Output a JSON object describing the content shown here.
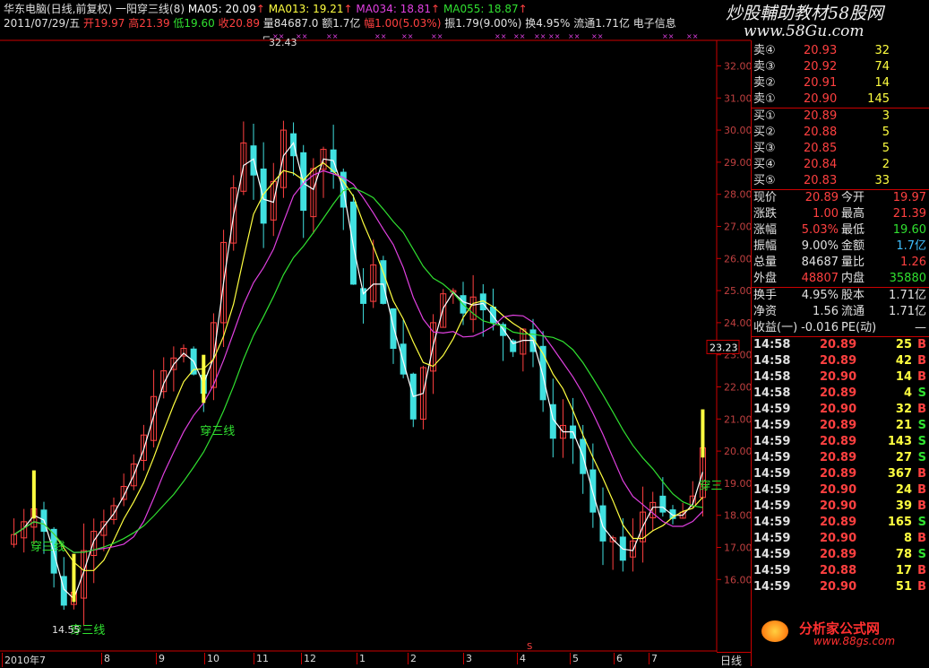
{
  "header": {
    "stock": "华东电脑(日线,前复权)",
    "formula": "一阳穿三线(8)",
    "ma05_label": "MA05: 20.09",
    "ma013_label": "MA013: 19.21",
    "ma034_label": "MA034: 18.81",
    "ma055_label": "MA055: 18.87",
    "date": "2011/07/29/五",
    "open": "开19.97",
    "high": "高21.39",
    "low": "低19.60",
    "close": "收20.89",
    "vol": "量84687.0",
    "amount": "额1.7亿",
    "change": "幅1.00(5.03%)",
    "amplitude": "振1.79(9.00%)",
    "turnover": "换4.95%",
    "float": "流通1.71亿",
    "sector": "电子信息"
  },
  "annotations": {
    "high_mark": "32.43",
    "low_mark": "14.55",
    "cross_label": "穿三线",
    "cross_label_edge": "穿三",
    "crosshair_price": "23.23",
    "s_mark": "S"
  },
  "y_axis": [
    "32.00",
    "31.00",
    "30.00",
    "29.00",
    "28.00",
    "27.00",
    "26.00",
    "25.00",
    "24.00",
    "23.00",
    "22.00",
    "21.00",
    "20.00",
    "19.00",
    "18.00",
    "17.00",
    "16.00"
  ],
  "x_axis": [
    "2010年7",
    "8",
    "9",
    "10",
    "11",
    "12",
    "1",
    "2",
    "3",
    "4",
    "5",
    "6",
    "7"
  ],
  "period_tab": "日线",
  "orderbook": {
    "sell": [
      {
        "label": "卖④",
        "price": "20.93",
        "vol": "32"
      },
      {
        "label": "卖③",
        "price": "20.92",
        "vol": "74"
      },
      {
        "label": "卖②",
        "price": "20.91",
        "vol": "14"
      },
      {
        "label": "卖①",
        "price": "20.90",
        "vol": "145"
      }
    ],
    "buy": [
      {
        "label": "买①",
        "price": "20.89",
        "vol": "3"
      },
      {
        "label": "买②",
        "price": "20.88",
        "vol": "5"
      },
      {
        "label": "买③",
        "price": "20.85",
        "vol": "5"
      },
      {
        "label": "买④",
        "price": "20.84",
        "vol": "2"
      },
      {
        "label": "买⑤",
        "price": "20.83",
        "vol": "33"
      }
    ]
  },
  "quote": [
    {
      "l1": "现价",
      "v1": "20.89",
      "l2": "今开",
      "v2": "19.97",
      "c1": "r",
      "c2": "r"
    },
    {
      "l1": "涨跌",
      "v1": "1.00",
      "l2": "最高",
      "v2": "21.39",
      "c1": "r",
      "c2": "r"
    },
    {
      "l1": "涨幅",
      "v1": "5.03%",
      "l2": "最低",
      "v2": "19.60",
      "c1": "r",
      "c2": "g"
    },
    {
      "l1": "振幅",
      "v1": "9.00%",
      "l2": "金额",
      "v2": "1.7亿",
      "c1": "w",
      "c2": "c"
    },
    {
      "l1": "总量",
      "v1": "84687",
      "l2": "量比",
      "v2": "1.26",
      "c1": "w",
      "c2": "r"
    },
    {
      "l1": "外盘",
      "v1": "48807",
      "l2": "内盘",
      "v2": "35880",
      "c1": "r",
      "c2": "g"
    },
    {
      "l1": "换手",
      "v1": "4.95%",
      "l2": "股本",
      "v2": "1.71亿",
      "c1": "w",
      "c2": "w"
    },
    {
      "l1": "净资",
      "v1": "1.56",
      "l2": "流通",
      "v2": "1.71亿",
      "c1": "w",
      "c2": "w"
    },
    {
      "l1": "收益(一)",
      "v1": "-0.016",
      "l2": "PE(动)",
      "v2": "—",
      "c1": "w",
      "c2": "w"
    }
  ],
  "ticks": [
    {
      "t": "14:58",
      "p": "20.89",
      "v": "25",
      "s": "B"
    },
    {
      "t": "14:58",
      "p": "20.89",
      "v": "42",
      "s": "B"
    },
    {
      "t": "14:58",
      "p": "20.90",
      "v": "14",
      "s": "B"
    },
    {
      "t": "14:58",
      "p": "20.89",
      "v": "4",
      "s": "S"
    },
    {
      "t": "14:59",
      "p": "20.90",
      "v": "32",
      "s": "B"
    },
    {
      "t": "14:59",
      "p": "20.89",
      "v": "21",
      "s": "S"
    },
    {
      "t": "14:59",
      "p": "20.89",
      "v": "143",
      "s": "S"
    },
    {
      "t": "14:59",
      "p": "20.89",
      "v": "27",
      "s": "S"
    },
    {
      "t": "14:59",
      "p": "20.89",
      "v": "367",
      "s": "B"
    },
    {
      "t": "14:59",
      "p": "20.90",
      "v": "24",
      "s": "B"
    },
    {
      "t": "14:59",
      "p": "20.90",
      "v": "39",
      "s": "B"
    },
    {
      "t": "14:59",
      "p": "20.89",
      "v": "165",
      "s": "S"
    },
    {
      "t": "14:59",
      "p": "20.90",
      "v": "8",
      "s": "B"
    },
    {
      "t": "14:59",
      "p": "20.89",
      "v": "78",
      "s": "S"
    },
    {
      "t": "14:59",
      "p": "20.88",
      "v": "17",
      "s": "B"
    },
    {
      "t": "14:59",
      "p": "20.90",
      "v": "51",
      "s": "B"
    }
  ],
  "watermark": {
    "top_line1": "炒股輔助教材58股网",
    "top_line2": "www.58Gu.com",
    "bottom_line1": "分析家公式网",
    "bottom_line2": "www.88gs.com"
  },
  "colors": {
    "up": "#ff4040",
    "down": "#30e030",
    "ma5": "#ffffff",
    "ma13": "#ffff40",
    "ma34": "#e040e0",
    "ma55": "#30e030",
    "border": "#cc0000"
  },
  "chart_data": {
    "type": "candlestick",
    "ylim": [
      14.5,
      32.6
    ],
    "close_approx": [
      17.4,
      17.8,
      18.2,
      17.5,
      16.2,
      15.2,
      15.6,
      16.9,
      17.5,
      17.8,
      18.3,
      18.9,
      19.6,
      20.5,
      21.7,
      22.5,
      22.9,
      23.2,
      22.4,
      21.8,
      24.0,
      26.5,
      28.2,
      29.6,
      28.6,
      27.1,
      28.4,
      30.0,
      29.2,
      27.5,
      28.8,
      29.4,
      28.7,
      27.6,
      25.2,
      24.6,
      25.8,
      24.6,
      23.2,
      22.4,
      21.0,
      22.6,
      24.0,
      24.9,
      25.0,
      24.3,
      24.8,
      24.4,
      24.0,
      23.6,
      23.1,
      23.8,
      23.1,
      21.6,
      20.4,
      20.8,
      20.4,
      19.3,
      18.1,
      17.2,
      17.3,
      16.6,
      17.2,
      18.1,
      18.4,
      18.1,
      17.9,
      18.1,
      18.6,
      20.1
    ]
  }
}
